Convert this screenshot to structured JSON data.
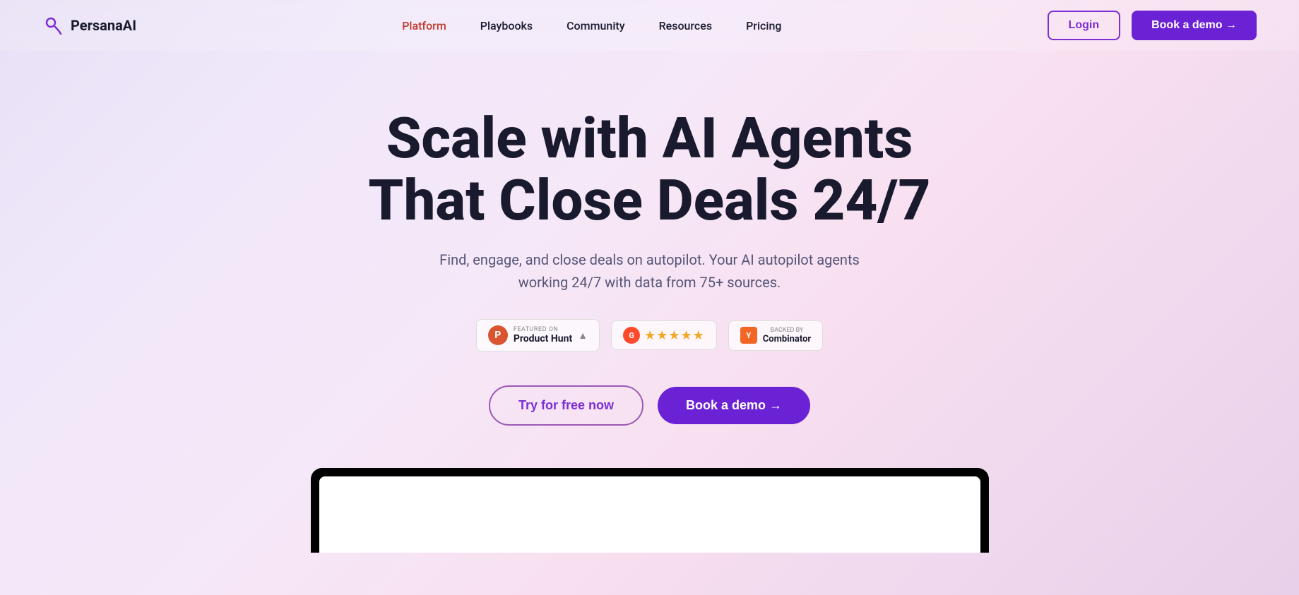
{
  "logo": {
    "text": "PersanaAI",
    "icon_label": "persana-logo-icon"
  },
  "nav": {
    "links": [
      {
        "label": "Platform",
        "active": true
      },
      {
        "label": "Playbooks",
        "active": false
      },
      {
        "label": "Community",
        "active": false
      },
      {
        "label": "Resources",
        "active": false
      },
      {
        "label": "Pricing",
        "active": false
      }
    ],
    "login_label": "Login",
    "demo_label": "Book a demo →"
  },
  "hero": {
    "title_line1": "Scale with AI Agents",
    "title_line2": "That Close Deals 24/7",
    "subtitle": "Find, engage, and close deals on autopilot. Your AI autopilot agents working 24/7 with data from 75+ sources.",
    "badges": {
      "product_hunt": {
        "featured_label": "FEATURED ON",
        "name": "Product Hunt",
        "arrow": "▲"
      },
      "g2": {
        "label": "G2",
        "stars": "★★★★★"
      },
      "yc": {
        "backed_label": "Backed by",
        "name": "Combinator"
      }
    },
    "cta_try": "Try for free now",
    "cta_demo": "Book a demo →"
  }
}
